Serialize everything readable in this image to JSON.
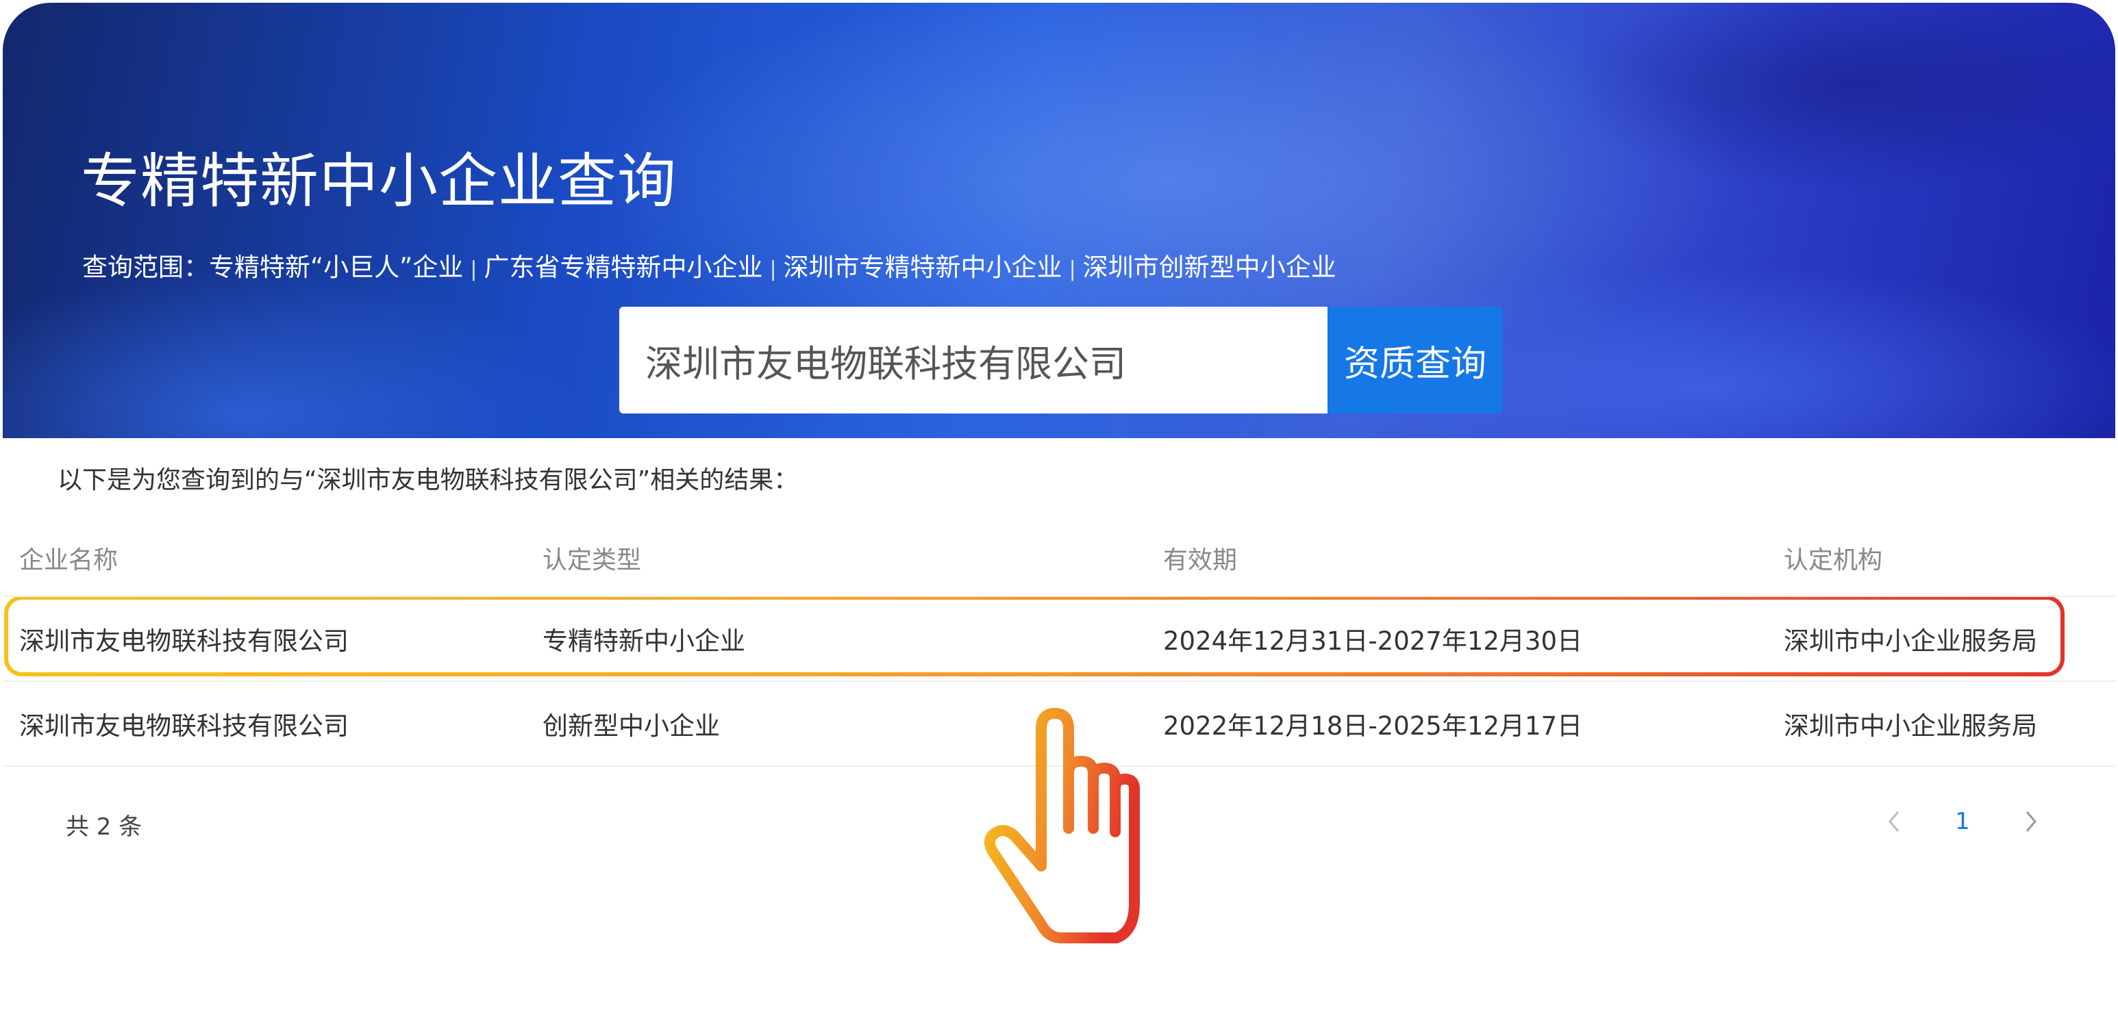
{
  "banner": {
    "title": "专精特新中小企业查询",
    "scope_prefix": "查询范围：",
    "scope_items": [
      "专精特新“小巨人”企业",
      "广东省专精特新中小企业",
      "深圳市专精特新中小企业",
      "深圳市创新型中小企业"
    ],
    "scope_separator": "|"
  },
  "search": {
    "value": "深圳市友电物联科技有限公司",
    "button_label": "资质查询"
  },
  "result_intro": "以下是为您查询到的与“深圳市友电物联科技有限公司”相关的结果：",
  "table": {
    "headers": [
      "企业名称",
      "认定类型",
      "有效期",
      "认定机构"
    ],
    "rows": [
      [
        "深圳市友电物联科技有限公司",
        "专精特新中小企业",
        "2024年12月31日-2027年12月30日",
        "深圳市中小企业服务局"
      ],
      [
        "深圳市友电物联科技有限公司",
        "创新型中小企业",
        "2022年12月18日-2025年12月17日",
        "深圳市中小企业服务局"
      ]
    ]
  },
  "footer": {
    "total": "共 2 条",
    "current_page": "1",
    "prev_icon": "chevron-left-icon",
    "next_icon": "chevron-right-icon"
  },
  "colors": {
    "accent": "#1677e6",
    "highlight_gradient_start": "#f6c21a",
    "highlight_gradient_end": "#e2342b"
  },
  "overlay_icon": "pointing-hand-icon"
}
